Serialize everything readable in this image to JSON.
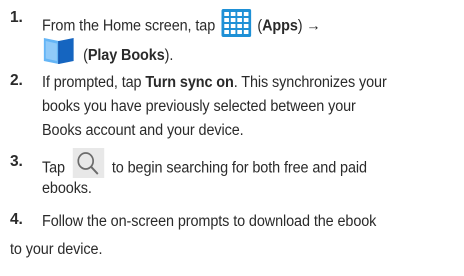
{
  "steps": [
    {
      "number": "1.",
      "line1": {
        "t1": "From the Home screen, tap",
        "t2": "(",
        "apps_label": "Apps",
        "t3": ") →"
      },
      "line2": {
        "t1": "(",
        "play_books_label": "Play Books",
        "t2": ")."
      }
    },
    {
      "number": "2.",
      "l1_pre": "If prompted, tap",
      "turn_sync_label": "Turn sync on",
      "l1_post": ". This synchronizes your",
      "l2": "books you have previously selected between your",
      "l3": "Books account and your device."
    },
    {
      "number": "3.",
      "l1_pre": "Tap",
      "l1_post": "to begin searching for both free and paid",
      "l2": "ebooks."
    },
    {
      "number": "4.",
      "l1": "Follow the on-screen prompts to download the ebook",
      "l2": "to your device."
    }
  ],
  "icons": {
    "apps": "apps-grid-icon",
    "play_books": "play-books-icon",
    "search": "search-icon"
  },
  "colors": {
    "apps_icon": "#1e90d6",
    "play_books_dark": "#1565c0",
    "play_books_light": "#64b5f6",
    "search_icon_bg": "#e8e8e8"
  }
}
